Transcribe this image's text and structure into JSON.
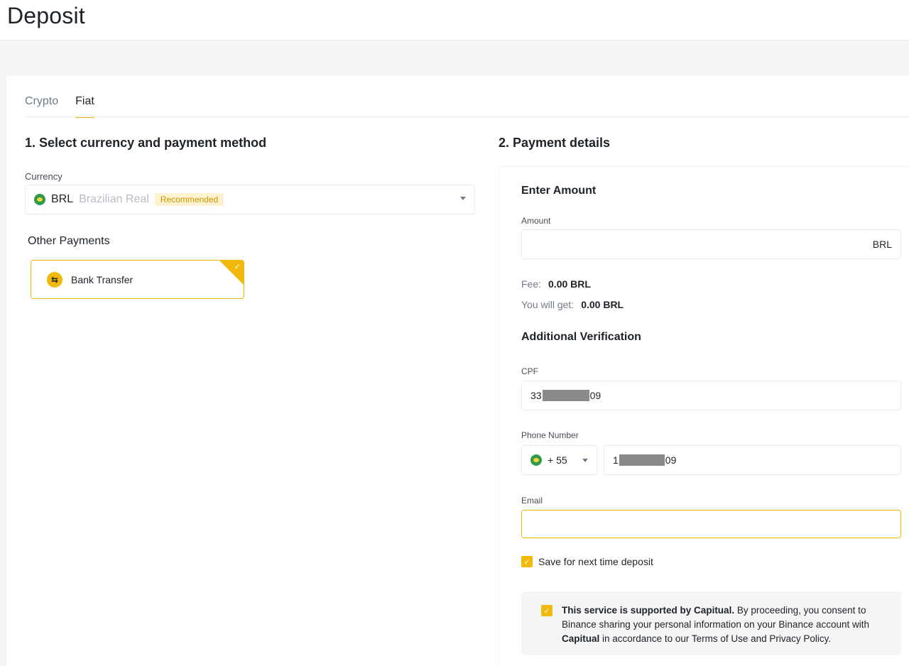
{
  "page": {
    "title": "Deposit"
  },
  "tabs": [
    {
      "label": "Crypto",
      "active": false
    },
    {
      "label": "Fiat",
      "active": true
    }
  ],
  "step1": {
    "title": "1. Select currency and payment method",
    "currency_label": "Currency",
    "currency": {
      "code": "BRL",
      "name": "Brazilian Real",
      "badge": "Recommended"
    },
    "other_payments_label": "Other Payments",
    "payment_method": {
      "label": "Bank Transfer",
      "selected": true
    }
  },
  "step2": {
    "title": "2. Payment details",
    "enter_amount_title": "Enter Amount",
    "amount_label": "Amount",
    "amount_value": "",
    "amount_suffix": "BRL",
    "fee_label": "Fee:",
    "fee_value": "0.00 BRL",
    "get_label": "You will get:",
    "get_value": "0.00 BRL",
    "verification_title": "Additional Verification",
    "cpf_label": "CPF",
    "cpf_prefix": "33",
    "cpf_suffix": "09",
    "phone_label": "Phone Number",
    "country_code": "+ 55",
    "phone_prefix": "1",
    "phone_suffix": "09",
    "email_label": "Email",
    "email_value": "",
    "save_label": "Save for next time deposit",
    "notice": {
      "bold_lead": "This service is supported by Capitual.",
      "text_1": " By proceeding, you consent to Binance sharing your personal information on your Binance account with ",
      "bold_partner": "Capitual",
      "text_2": " in accordance to our Terms of Use and Privacy Policy."
    }
  },
  "colors": {
    "accent": "#f0b90b",
    "text": "#1e2329",
    "muted": "#707a8a"
  }
}
